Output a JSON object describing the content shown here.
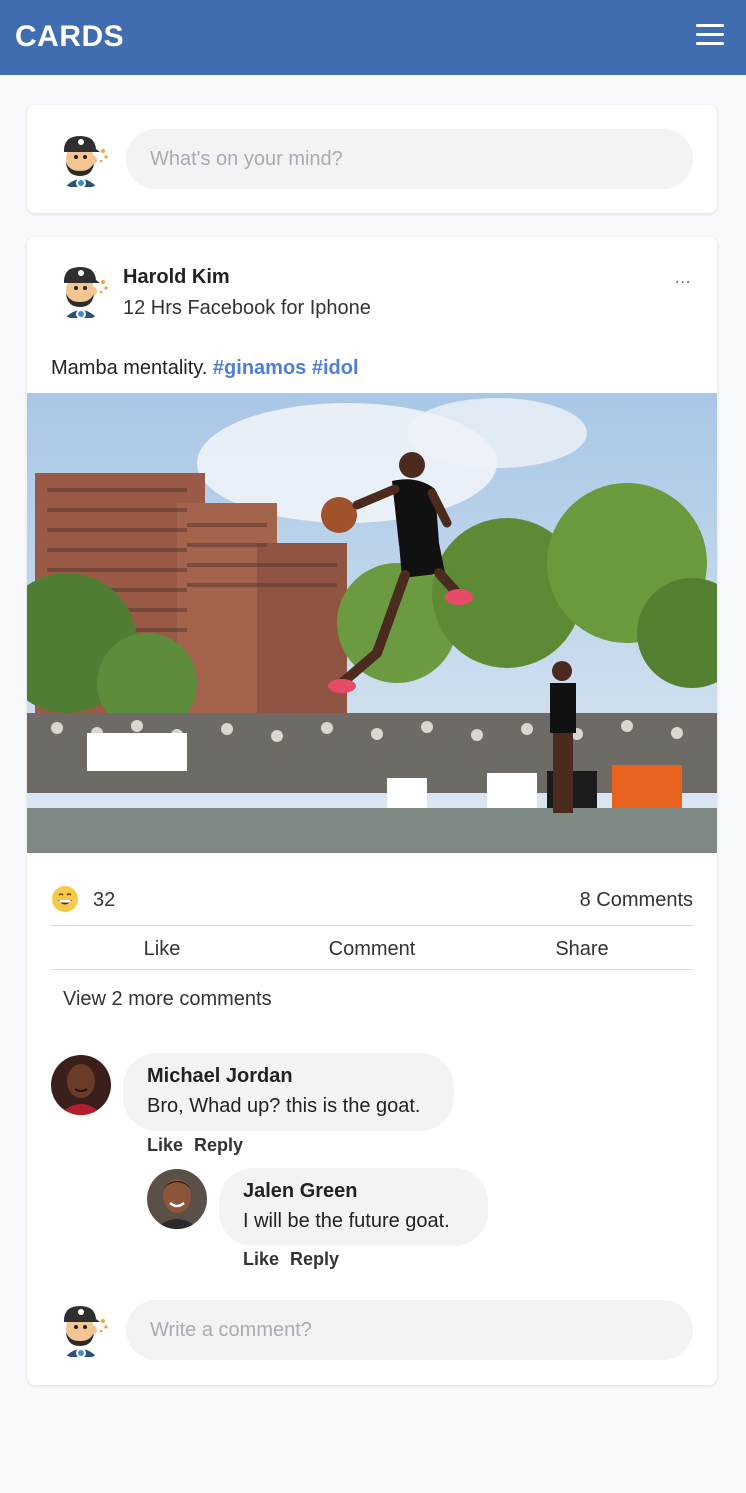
{
  "header": {
    "brand": "CARDS",
    "menu_icon": "hamburger-menu-icon",
    "colors": {
      "bar": "#3f6db0",
      "text": "#ffffff"
    }
  },
  "composer": {
    "placeholder": "What's on your mind?"
  },
  "post": {
    "author": "Harold Kim",
    "meta": "12 Hrs Facebook for Iphone",
    "more_label": "...",
    "text": "Mamba mentality.",
    "hashtags": [
      "#ginamos",
      "#idol"
    ],
    "hashtag_color": "#4d7fd8",
    "reaction_icon": "grinning-face-icon",
    "reaction_count": "32",
    "comments_count": "8 Comments",
    "actions": {
      "like": "Like",
      "comment": "Comment",
      "share": "Share"
    },
    "view_more": "View 2 more comments"
  },
  "comments": [
    {
      "name": "Michael Jordan",
      "text": "Bro, Whad up? this is the goat.",
      "like": "Like",
      "reply": "Reply"
    },
    {
      "name": "Jalen Green",
      "text": "I will be the future goat.",
      "like": "Like",
      "reply": "Reply"
    }
  ],
  "comment_input": {
    "placeholder": "Write a comment?"
  }
}
